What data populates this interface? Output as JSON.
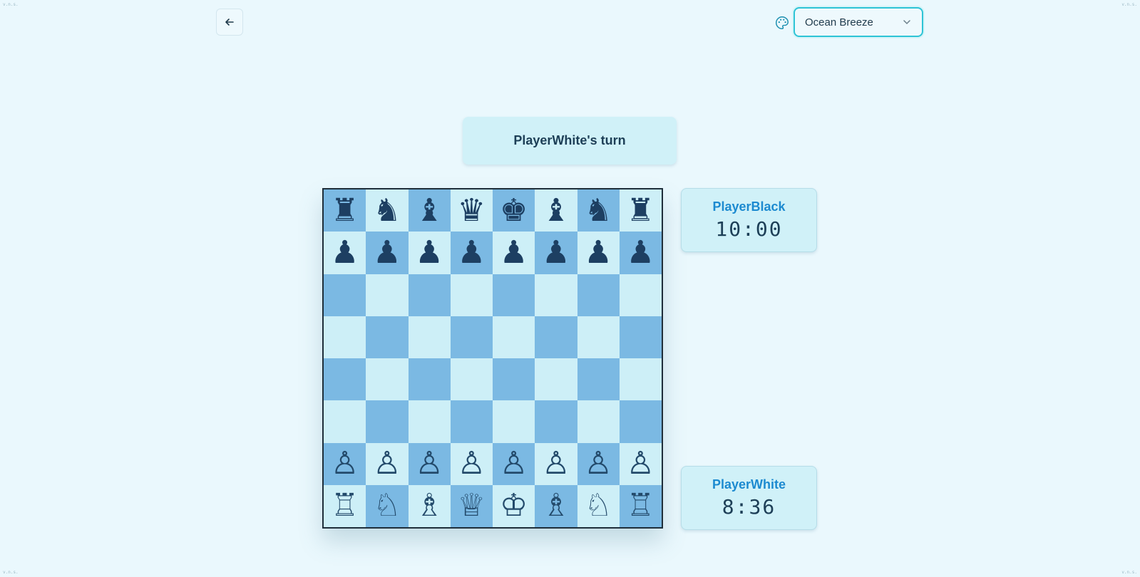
{
  "corner_label": "v.n.s.",
  "theme": {
    "selected": "Ocean Breeze",
    "palette_icon": "palette-icon",
    "chevron_icon": "chevron-down-icon"
  },
  "back_icon": "arrow-left-icon",
  "status": {
    "turn_text": "PlayerWhite's turn"
  },
  "players": {
    "black": {
      "name": "PlayerBlack",
      "clock": "10:00"
    },
    "white": {
      "name": "PlayerWhite",
      "clock": "8:36"
    }
  },
  "board": {
    "rows": [
      [
        "bR",
        "bN",
        "bB",
        "bQ",
        "bK",
        "bB",
        "bN",
        "bR"
      ],
      [
        "bP",
        "bP",
        "bP",
        "bP",
        "bP",
        "bP",
        "bP",
        "bP"
      ],
      [
        "",
        "",
        "",
        "",
        "",
        "",
        "",
        ""
      ],
      [
        "",
        "",
        "",
        "",
        "",
        "",
        "",
        ""
      ],
      [
        "",
        "",
        "",
        "",
        "",
        "",
        "",
        ""
      ],
      [
        "",
        "",
        "",
        "",
        "",
        "",
        "",
        ""
      ],
      [
        "wP",
        "wP",
        "wP",
        "wP",
        "wP",
        "wP",
        "wP",
        "wP"
      ],
      [
        "wR",
        "wN",
        "wB",
        "wQ",
        "wK",
        "wB",
        "wN",
        "wR"
      ]
    ],
    "colors": {
      "light": "#cdeff7",
      "dark": "#7bb9e3"
    }
  }
}
